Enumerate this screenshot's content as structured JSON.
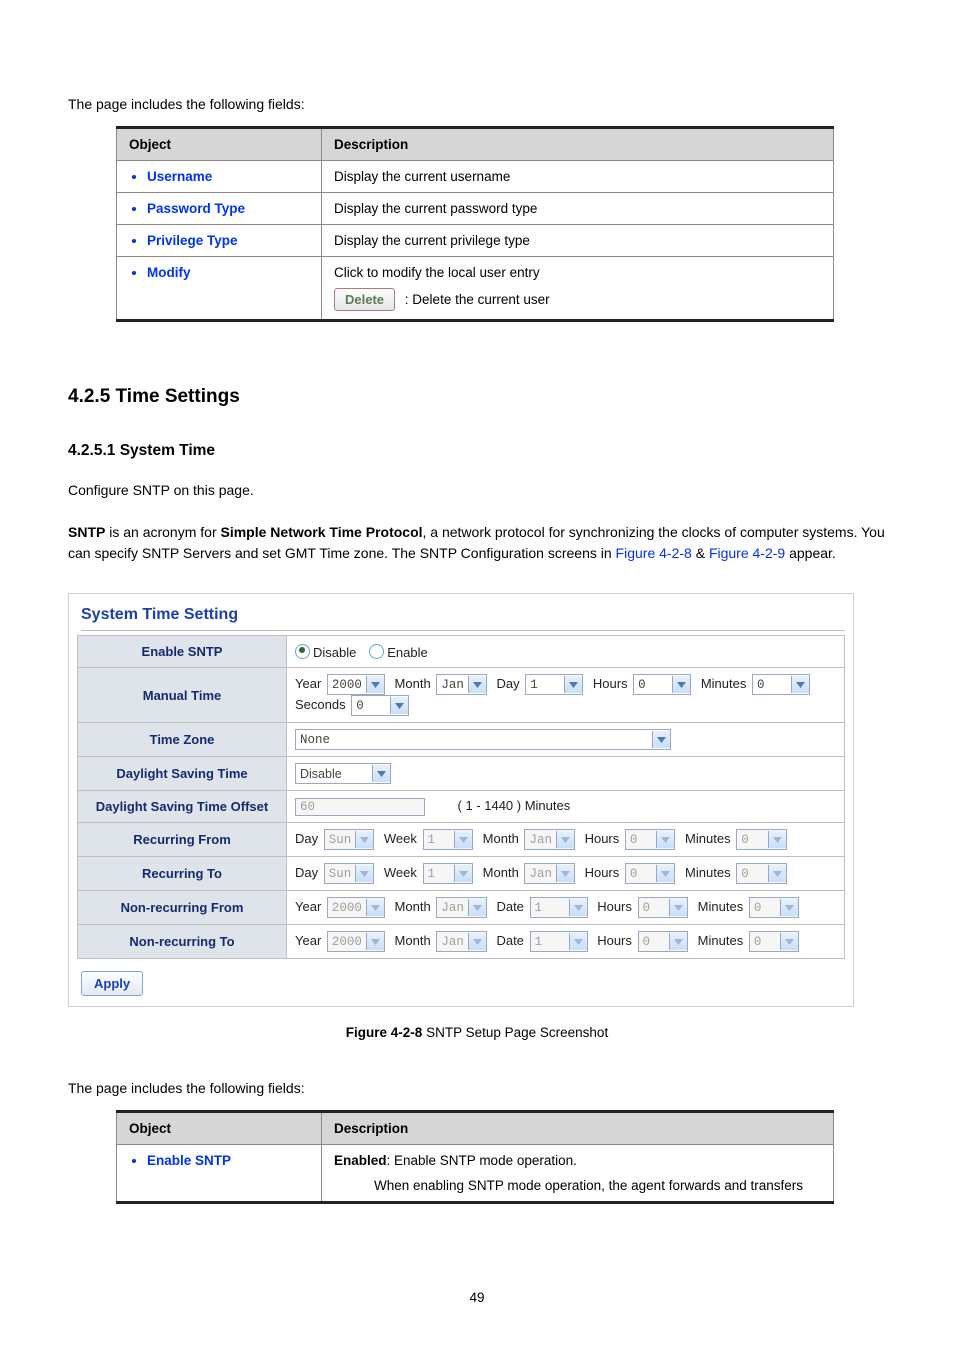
{
  "intro1": "The page includes the following fields:",
  "table1": {
    "headers": {
      "object": "Object",
      "description": "Description"
    },
    "rows": [
      {
        "obj": "Username",
        "desc": "Display the current username"
      },
      {
        "obj": "Password Type",
        "desc": "Display the current password type"
      },
      {
        "obj": "Privilege Type",
        "desc": "Display the current privilege type"
      },
      {
        "obj": "Modify",
        "desc_line1": "Click to modify the local user entry",
        "btn": "Delete",
        "desc_line2": ": Delete the current user"
      }
    ]
  },
  "sec": "4.2.5 Time Settings",
  "sub": "4.2.5.1 System Time",
  "para1": "Configure SNTP on this page.",
  "para2_a": "SNTP",
  "para2_b": " is an acronym for ",
  "para2_c": "Simple Network Time Protocol",
  "para2_d": ", a network protocol for synchronizing the clocks of computer systems. You can specify SNTP Servers and set GMT Time zone. The SNTP Configuration screens in ",
  "para2_link1": "Figure 4-2-8",
  "para2_e": " & ",
  "para2_link2": "Figure 4-2-9",
  "para2_f": " appear.",
  "shot_title": "System Time Setting",
  "labels": {
    "enable_sntp": "Enable SNTP",
    "manual_time": "Manual Time",
    "time_zone": "Time Zone",
    "dst": "Daylight Saving Time",
    "dst_offset": "Daylight Saving Time Offset",
    "rec_from": "Recurring From",
    "rec_to": "Recurring To",
    "nrec_from": "Non-recurring From",
    "nrec_to": "Non-recurring To",
    "disable": "Disable",
    "enable": "Enable",
    "year": "Year",
    "month": "Month",
    "day": "Day",
    "hours": "Hours",
    "minutes": "Minutes",
    "seconds": "Seconds",
    "week": "Week",
    "date": "Date"
  },
  "vals": {
    "year": "2000",
    "month": "Jan",
    "day": "1",
    "hours": "0",
    "minutes": "0",
    "seconds": "0",
    "tz": "None",
    "dst_mode": "Disable",
    "offset": "60",
    "offset_hint": "( 1 - 1440 ) Minutes",
    "day_sun": "Sun",
    "week1": "1",
    "date1": "1"
  },
  "apply": "Apply",
  "caption_a": "Figure 4-2-8",
  "caption_b": " SNTP Setup Page Screenshot",
  "intro2": "The page includes the following fields:",
  "table2": {
    "headers": {
      "object": "Object",
      "description": "Description"
    },
    "rows": [
      {
        "obj": "Enable SNTP",
        "desc_b": "Enabled",
        "desc_1": ": Enable SNTP mode operation.",
        "desc_2": "When enabling SNTP mode operation, the agent forwards and transfers"
      }
    ]
  },
  "page_num": "49"
}
